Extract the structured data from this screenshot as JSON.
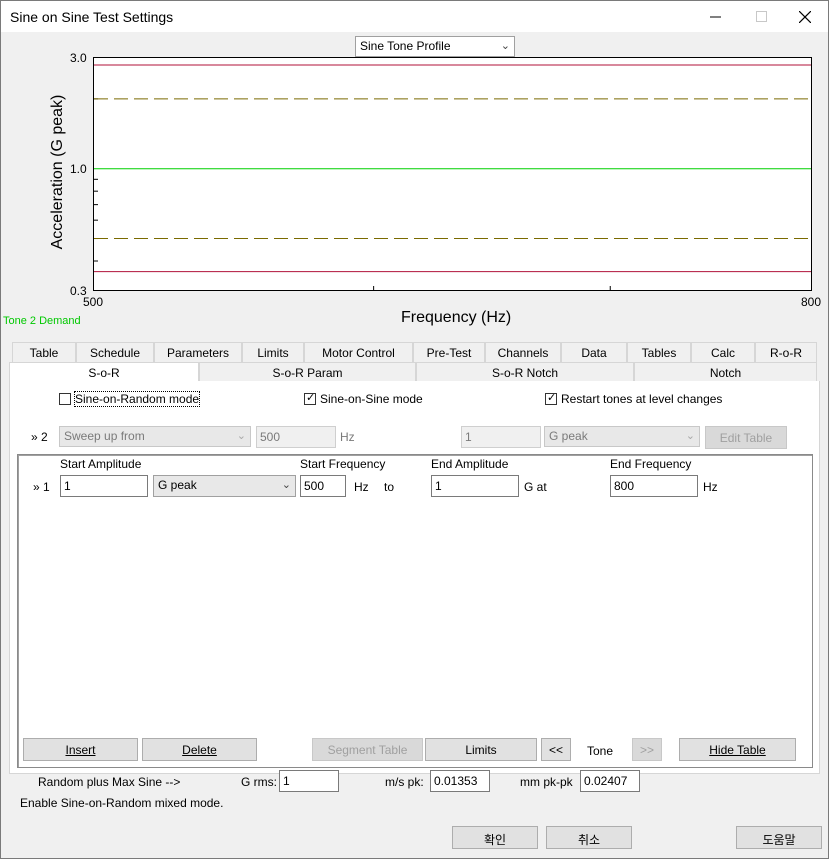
{
  "window": {
    "title": "Sine on Sine Test Settings"
  },
  "profile_select": {
    "value": "Sine Tone Profile"
  },
  "chart_data": {
    "type": "line",
    "xlabel": "Frequency (Hz)",
    "ylabel": "Acceleration (G peak)",
    "x_ticks": [
      "500",
      "800"
    ],
    "y_ticks": [
      "3.0",
      "1.0",
      "0.3"
    ],
    "xlim": [
      500,
      800
    ],
    "ylim": [
      0.3,
      3.0
    ],
    "y_scale": "log",
    "series_legend": "Tone 2 Demand",
    "series": [
      {
        "values": [
          2.8,
          2.8
        ],
        "style": "solid",
        "color": "#b0123a"
      },
      {
        "values": [
          2.0,
          2.0
        ],
        "style": "dashed",
        "color": "#7a6a00"
      },
      {
        "values": [
          1.0,
          1.0
        ],
        "style": "solid",
        "color": "#00d000"
      },
      {
        "values": [
          0.5,
          0.5
        ],
        "style": "dashed",
        "color": "#7a6a00"
      },
      {
        "values": [
          0.36,
          0.36
        ],
        "style": "solid",
        "color": "#b0123a"
      }
    ]
  },
  "tabs_row1": [
    "Table",
    "Schedule",
    "Parameters",
    "Limits",
    "Motor Control",
    "Pre-Test",
    "Channels",
    "Data",
    "Tables",
    "Calc",
    "R-o-R"
  ],
  "tabs_row2": [
    "S-o-R",
    "S-o-R Param",
    "S-o-R Notch",
    "Notch"
  ],
  "options": {
    "sine_on_random": "Sine-on-Random mode",
    "sine_on_sine": "Sine-on-Sine mode",
    "restart_tones": "Restart tones at level changes"
  },
  "row2": {
    "marker": "» 2",
    "sweep": "Sweep up from",
    "freq": "500",
    "hz": "Hz",
    "amp": "1",
    "units": "G peak",
    "edit_table": "Edit Table"
  },
  "segment": {
    "h_start_amp": "Start Amplitude",
    "h_start_freq": "Start Frequency",
    "h_end_amp": "End Amplitude",
    "h_end_freq": "End Frequency",
    "marker": "» 1",
    "start_amp": "1",
    "units": "G peak",
    "start_freq": "500",
    "hz": "Hz",
    "to": "to",
    "end_amp": "1",
    "g_at": "G at",
    "end_freq": "800",
    "hz2": "Hz"
  },
  "buttons": {
    "insert": "Insert",
    "delete": "Delete",
    "segment_table": "Segment Table",
    "limits": "Limits",
    "prev": "<<",
    "tone": "Tone",
    "next": ">>",
    "hide_table": "Hide Table"
  },
  "footer": {
    "random_label": "Random plus Max Sine -->",
    "grms_label": "G rms:",
    "grms": "1",
    "ms_label": "m/s pk:",
    "ms": "0.01353",
    "mm_label": "mm pk-pk",
    "mm": "0.02407",
    "status": "Enable Sine-on-Random mixed mode.",
    "ok": "확인",
    "cancel": "취소",
    "help": "도움말"
  }
}
